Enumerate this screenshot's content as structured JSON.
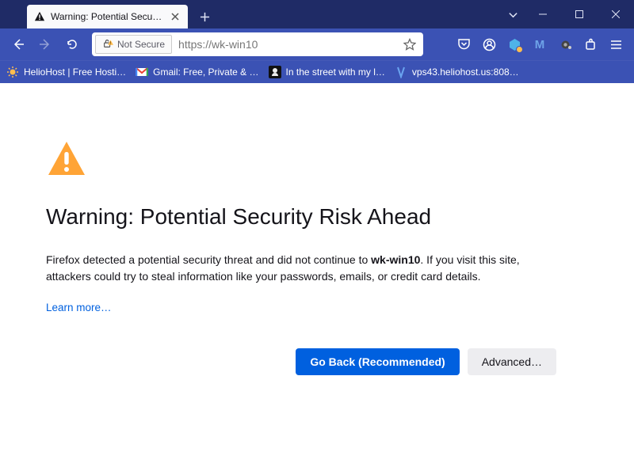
{
  "tab": {
    "title": "Warning: Potential Security Risk"
  },
  "urlbar": {
    "identity_label": "Not Secure",
    "url": "https://wk-win10"
  },
  "bookmarks": [
    {
      "label": "HelioHost | Free Hosti…",
      "icon": "sun"
    },
    {
      "label": "Gmail: Free, Private & …",
      "icon": "gmail"
    },
    {
      "label": "In the street with my l…",
      "icon": "octopus"
    },
    {
      "label": "vps43.heliohost.us:808…",
      "icon": "vps"
    }
  ],
  "error": {
    "title": "Warning: Potential Security Risk Ahead",
    "desc_prefix": "Firefox detected a potential security threat and did not continue to ",
    "hostname": "wk-win10",
    "desc_suffix": ". If you visit this site, attackers could try to steal information like your passwords, emails, or credit card details.",
    "learn_more": "Learn more…",
    "go_back": "Go Back (Recommended)",
    "advanced": "Advanced…"
  }
}
